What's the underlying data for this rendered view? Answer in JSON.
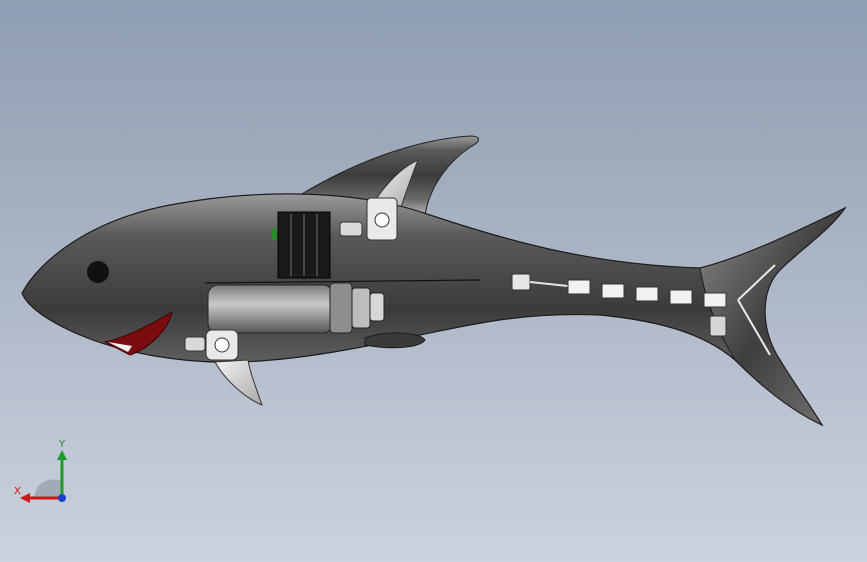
{
  "viewport": {
    "background_top": "#8f9db2",
    "background_bottom": "#ccd3de",
    "model": {
      "name": "robotic-shark-assembly",
      "body_color": "#4a4a4a",
      "mouth_color": "#7a0c10",
      "fin_color": "#d8d8d8",
      "component_color": "#efefef"
    }
  },
  "triad": {
    "y_label": "Y",
    "x_label": "X",
    "y_color": "#1f9a2a",
    "x_color": "#c81818",
    "z_color": "#1c3fd0"
  }
}
